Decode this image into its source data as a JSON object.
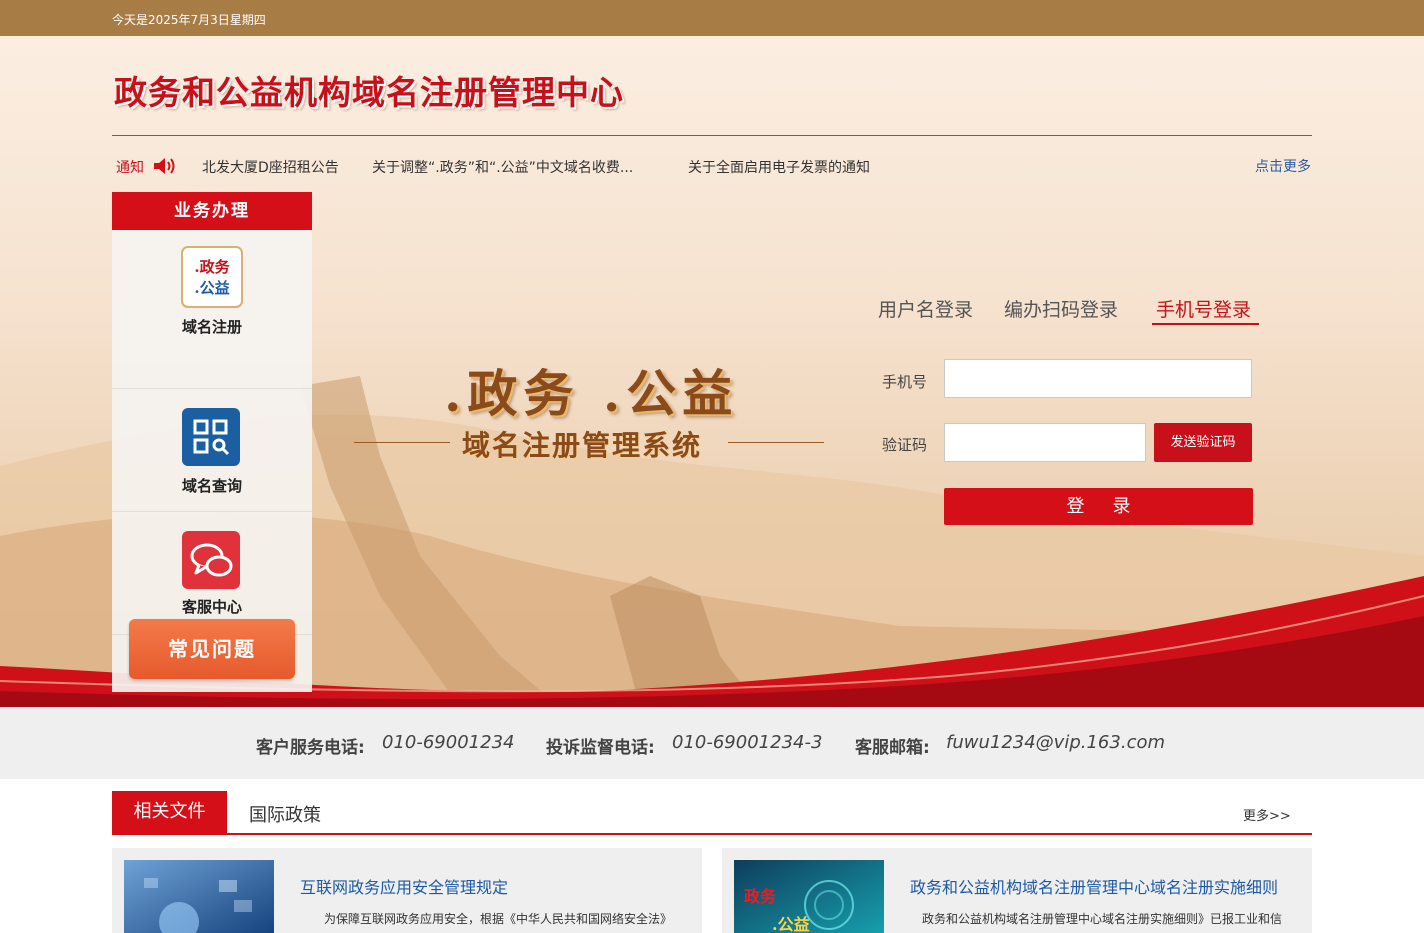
{
  "top_bar": {
    "date": "今天是2025年7月3日星期四"
  },
  "header": {
    "site_title": "政务和公益机构域名注册管理中心"
  },
  "notice": {
    "label": "通知",
    "items": [
      "北发大厦D座招租公告",
      "关于调整“.政务”和“.公益”中文域名收费...",
      "关于全面启用电子发票的通知"
    ],
    "more": "点击更多"
  },
  "sidebar": {
    "header": "业务办理",
    "items": [
      {
        "label": "域名注册",
        "icon": "domain-register-icon",
        "icon_text_1": ".政务",
        "icon_text_2": ".公益"
      },
      {
        "label": "域名查询",
        "icon": "qr-search-icon"
      },
      {
        "label": "客服中心",
        "icon": "chat-bubbles-icon"
      }
    ],
    "faq_button": "常见问题"
  },
  "logo": {
    "line1": ".政务 .公益",
    "line2": "域名注册管理系统"
  },
  "login": {
    "tabs": [
      "用户名登录",
      "编办扫码登录",
      "手机号登录"
    ],
    "active_tab": 2,
    "phone_label": "手机号",
    "phone_value": "",
    "code_label": "验证码",
    "code_value": "",
    "send_code_button": "发送验证码",
    "submit_button": "登录"
  },
  "contact": {
    "service_label": "客户服务电话:",
    "service_phone": "010-69001234",
    "complaint_label": "投诉监督电话:",
    "complaint_phone": "010-69001234-3",
    "email_label": "客服邮箱:",
    "email": "fuwu1234@vip.163.com"
  },
  "documents": {
    "tabs": [
      "相关文件",
      "国际政策"
    ],
    "more": "更多>>",
    "cards": [
      {
        "title": "互联网政务应用安全管理规定",
        "desc": "为保障互联网政务应用安全，根据《中华人民共和国网络安全法》"
      },
      {
        "title": "政务和公益机构域名注册管理中心域名注册实施细则",
        "desc": "政务和公益机构域名注册管理中心域名注册实施细则》已报工业和信",
        "thumb_text_1": "政务",
        "thumb_text_2": ".公益"
      }
    ]
  },
  "colors": {
    "brand_red": "#d40f18",
    "top_bar": "#a87c45",
    "link_blue": "#1c5aa6"
  }
}
